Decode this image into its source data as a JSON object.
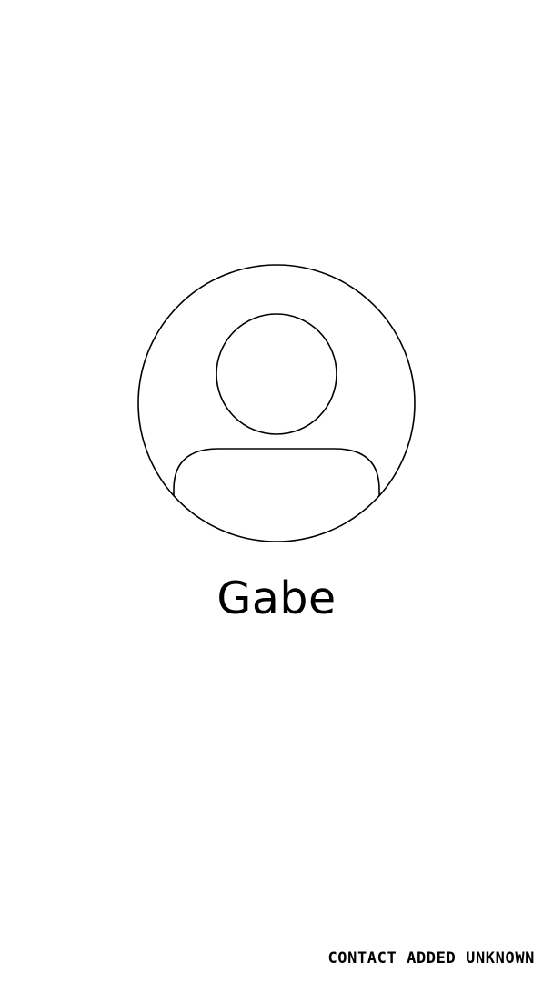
{
  "contact": {
    "name": "Gabe",
    "avatar_icon": "default-person-avatar-icon"
  },
  "status": {
    "text": "CONTACT ADDED UNKNOWN"
  },
  "colors": {
    "background": "#ffffff",
    "foreground": "#000000"
  }
}
